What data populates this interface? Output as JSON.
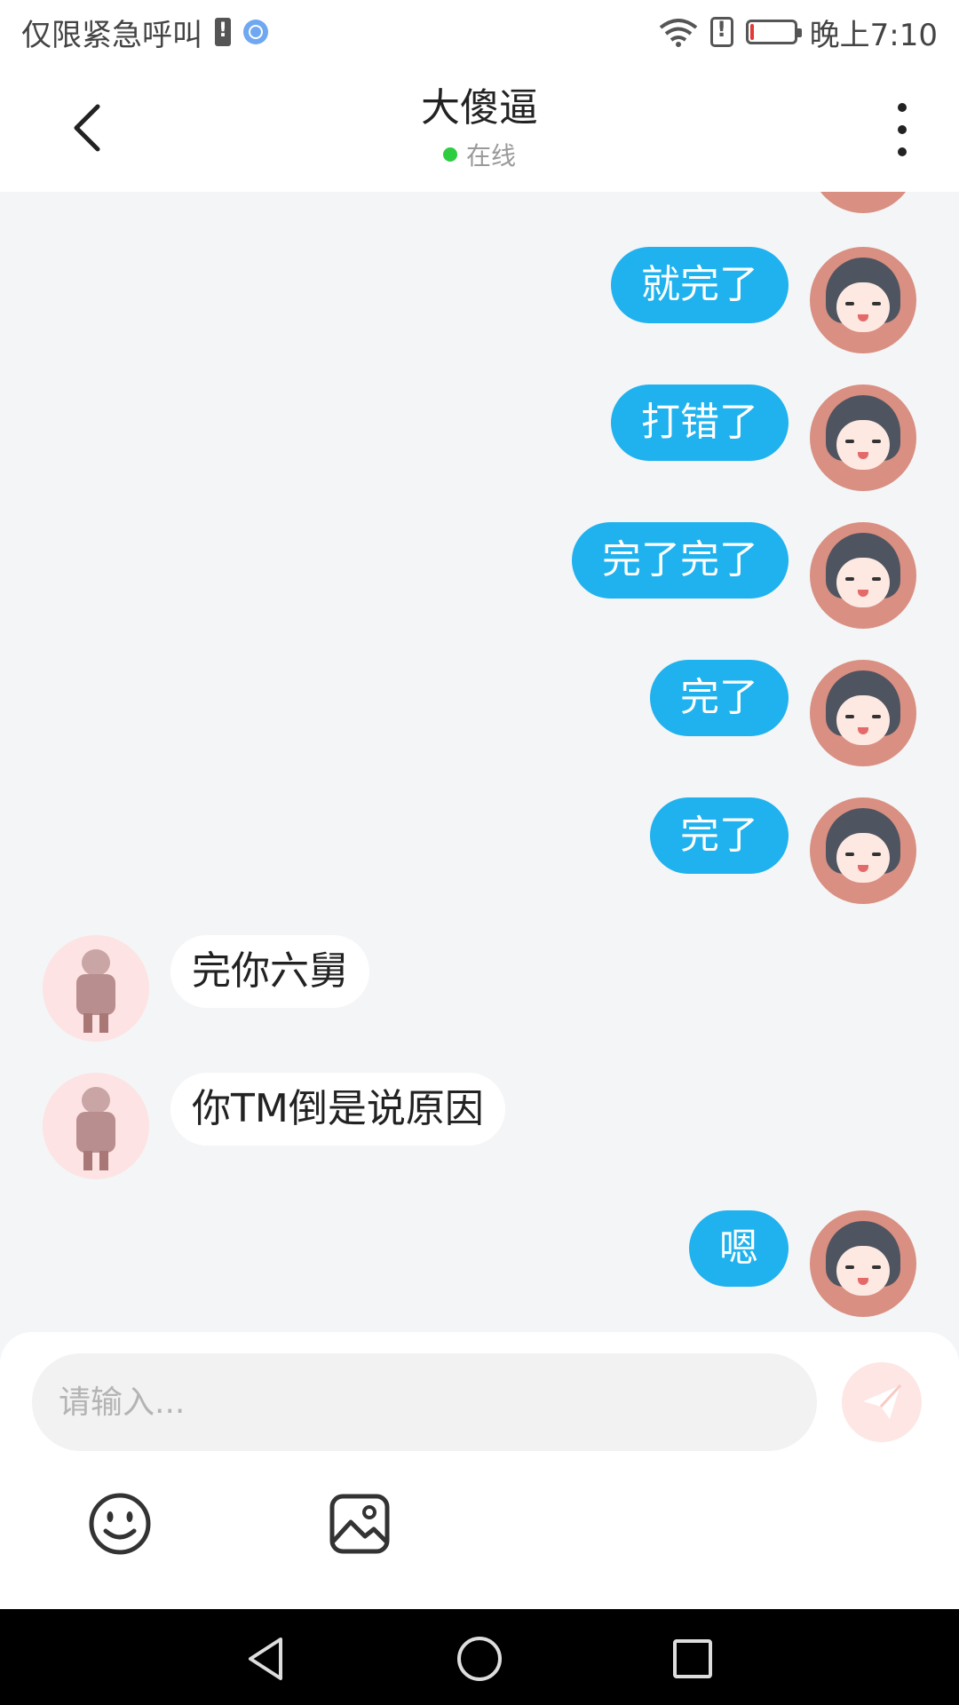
{
  "status_bar": {
    "carrier_text": "仅限紧急呼叫",
    "time": "晚上7:10",
    "battery_level": 0.08,
    "icons": [
      "sim-alert-icon",
      "globe-icon",
      "wifi-icon",
      "alert-icon",
      "battery-icon"
    ]
  },
  "header": {
    "title": "大傻逼",
    "presence": "在线",
    "presence_color": "#2ecc40",
    "back_icon": "chevron-left-icon",
    "menu_icon": "more-vertical-icon"
  },
  "messages": [
    {
      "from": "self",
      "text": "就完了"
    },
    {
      "from": "self",
      "text": "打错了"
    },
    {
      "from": "self",
      "text": "完了完了"
    },
    {
      "from": "self",
      "text": "完了"
    },
    {
      "from": "self",
      "text": "完了"
    },
    {
      "from": "other",
      "text": "完你六舅"
    },
    {
      "from": "other",
      "text": "你TM倒是说原因"
    },
    {
      "from": "self",
      "text": "嗯"
    }
  ],
  "composer": {
    "placeholder": "请输入...",
    "send_icon": "paper-plane-icon",
    "tools": [
      "emoji-icon",
      "image-icon"
    ]
  },
  "colors": {
    "self_bubble": "#1fb2ee",
    "other_bubble": "#ffffff",
    "background": "#f4f5f7"
  },
  "nav_bar": [
    "back-triangle-icon",
    "home-circle-icon",
    "recents-square-icon"
  ]
}
